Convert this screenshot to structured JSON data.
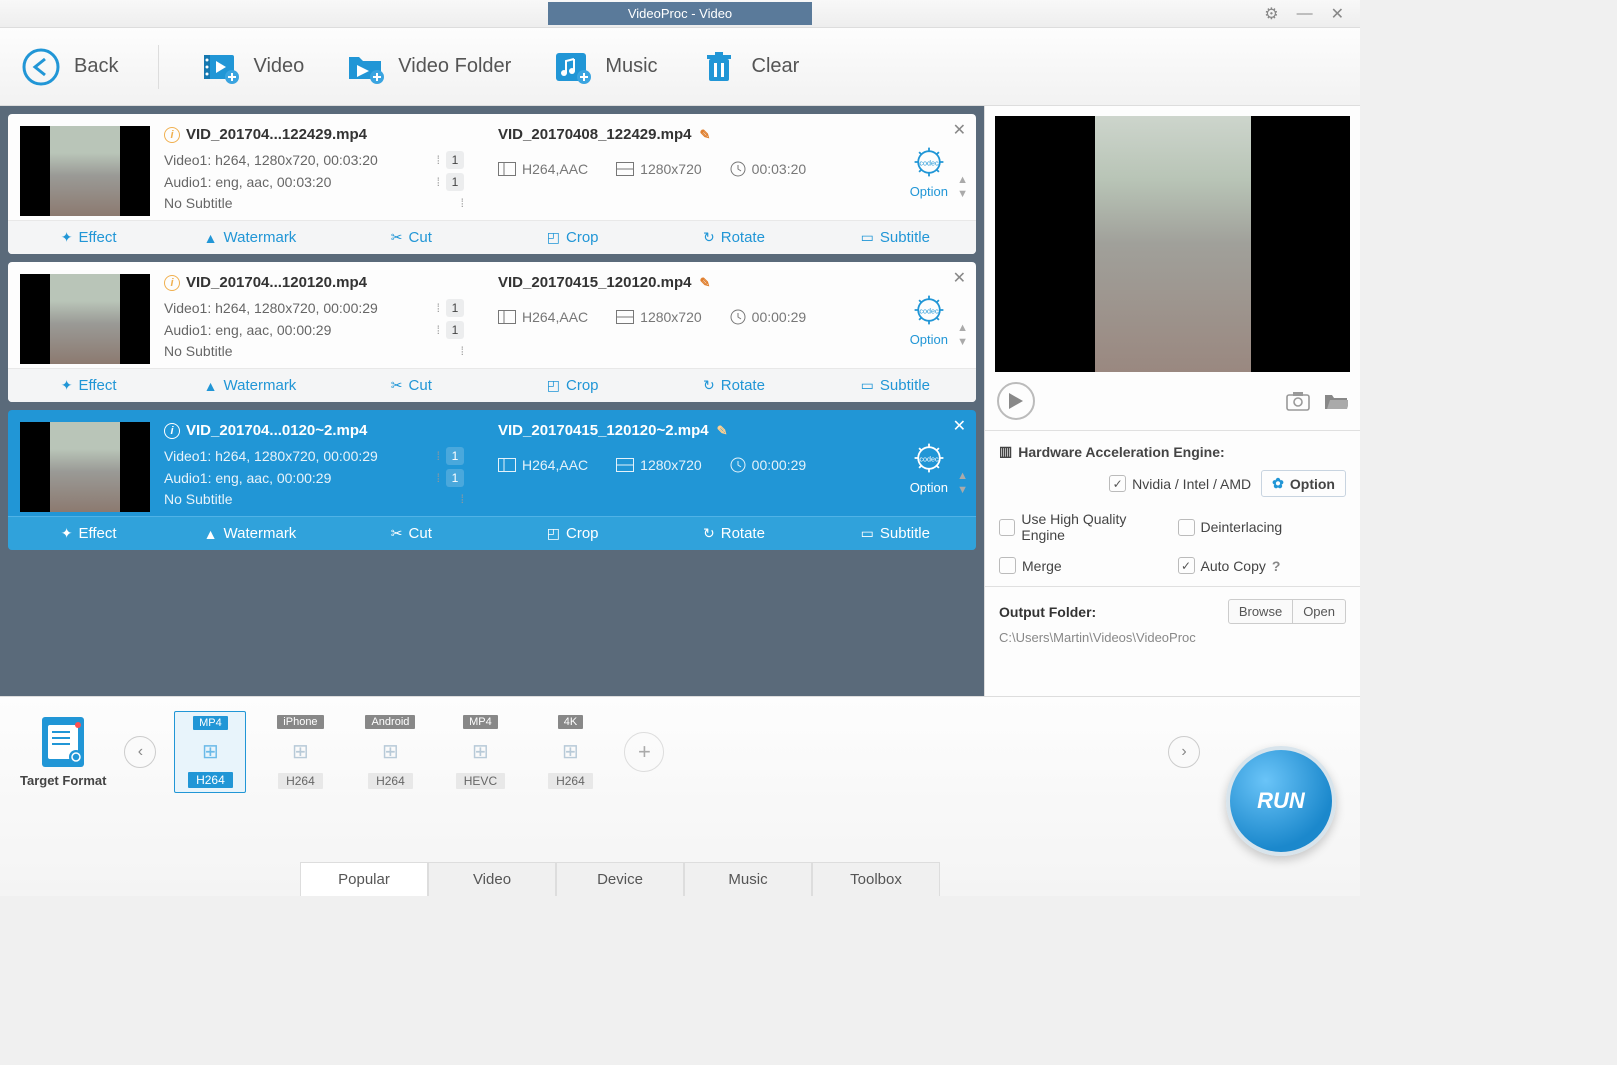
{
  "titlebar": {
    "title": "VideoProc - Video"
  },
  "toolbar": {
    "back": "Back",
    "video": "Video",
    "folder": "Video Folder",
    "music": "Music",
    "clear": "Clear"
  },
  "videos": [
    {
      "src_name": "VID_201704...122429.mp4",
      "video_track": "Video1: h264, 1280x720, 00:03:20",
      "audio_track": "Audio1: eng, aac, 00:03:20",
      "subtitle": "No Subtitle",
      "v_count": "1",
      "a_count": "1",
      "out_name": "VID_20170408_122429.mp4",
      "codec": "H264,AAC",
      "res": "1280x720",
      "dur": "00:03:20",
      "selected": false
    },
    {
      "src_name": "VID_201704...120120.mp4",
      "video_track": "Video1: h264, 1280x720, 00:00:29",
      "audio_track": "Audio1: eng, aac, 00:00:29",
      "subtitle": "No Subtitle",
      "v_count": "1",
      "a_count": "1",
      "out_name": "VID_20170415_120120.mp4",
      "codec": "H264,AAC",
      "res": "1280x720",
      "dur": "00:00:29",
      "selected": false
    },
    {
      "src_name": "VID_201704...0120~2.mp4",
      "video_track": "Video1: h264, 1280x720, 00:00:29",
      "audio_track": "Audio1: eng, aac, 00:00:29",
      "subtitle": "No Subtitle",
      "v_count": "1",
      "a_count": "1",
      "out_name": "VID_20170415_120120~2.mp4",
      "codec": "H264,AAC",
      "res": "1280x720",
      "dur": "00:00:29",
      "selected": true
    }
  ],
  "actions": {
    "effect": "Effect",
    "watermark": "Watermark",
    "cut": "Cut",
    "crop": "Crop",
    "rotate": "Rotate",
    "subtitle": "Subtitle",
    "option": "Option"
  },
  "hw": {
    "title": "Hardware Acceleration Engine:",
    "vendor": "Nvidia / Intel / AMD",
    "option_btn": "Option",
    "hq": "Use High Quality Engine",
    "deint": "Deinterlacing",
    "merge": "Merge",
    "autocopy": "Auto Copy",
    "vendor_checked": true,
    "hq_checked": false,
    "deint_checked": false,
    "merge_checked": false,
    "autocopy_checked": true
  },
  "output": {
    "label": "Output Folder:",
    "browse": "Browse",
    "open": "Open",
    "path": "C:\\Users\\Martin\\Videos\\VideoProc"
  },
  "target_format_label": "Target Format",
  "formats": [
    {
      "top": "MP4",
      "bottom": "H264",
      "selected": true
    },
    {
      "top": "iPhone",
      "bottom": "H264",
      "selected": false
    },
    {
      "top": "Android",
      "bottom": "H264",
      "selected": false
    },
    {
      "top": "MP4",
      "bottom": "HEVC",
      "selected": false
    },
    {
      "top": "4K",
      "bottom": "H264",
      "selected": false
    }
  ],
  "tabs": [
    "Popular",
    "Video",
    "Device",
    "Music",
    "Toolbox"
  ],
  "active_tab": "Popular",
  "run": "RUN"
}
